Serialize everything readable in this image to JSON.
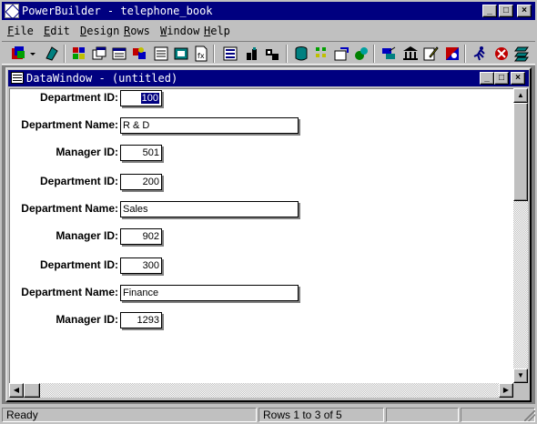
{
  "app": {
    "title": "PowerBuilder - telephone_book",
    "buttons": {
      "minimize": "_",
      "maximize": "□",
      "close": "×"
    }
  },
  "menu": [
    {
      "accel": "F",
      "rest": "ile"
    },
    {
      "accel": "E",
      "rest": "dit"
    },
    {
      "accel": "D",
      "rest": "esign"
    },
    {
      "accel": "R",
      "rest": "ows"
    },
    {
      "accel": "W",
      "rest": "indow"
    },
    {
      "accel": "H",
      "rest": "elp"
    }
  ],
  "toolbar": {
    "icons": [
      "new-wizard-icon",
      "dropdown-arrow-icon",
      "open-icon",
      "application-icon",
      "window-icon",
      "menu-icon",
      "structure-icon",
      "datawindow-icon",
      "query-icon",
      "function-icon",
      "library-icon",
      "run-icon",
      "debug-icon",
      "database-icon",
      "database-painter-icon",
      "pipeline-icon",
      "report-icon",
      "object-browser-icon",
      "preview-icon",
      "bank-icon",
      "edit-icon",
      "color-icon",
      "runner-icon",
      "stop-icon",
      "library-painter-icon"
    ]
  },
  "datawindow": {
    "title": "DataWindow - (untitled)",
    "records": [
      {
        "dept_id_label": "Department ID:",
        "dept_id": "100",
        "dept_name_label": "Department Name:",
        "dept_name": "R & D",
        "manager_label": "Manager ID:",
        "manager_id": "501"
      },
      {
        "dept_id_label": "Department ID:",
        "dept_id": "200",
        "dept_name_label": "Department Name:",
        "dept_name": "Sales",
        "manager_label": "Manager ID:",
        "manager_id": "902"
      },
      {
        "dept_id_label": "Department ID:",
        "dept_id": "300",
        "dept_name_label": "Department Name:",
        "dept_name": "Finance",
        "manager_label": "Manager ID:",
        "manager_id": "1293"
      }
    ]
  },
  "scroll": {
    "up": "▲",
    "down": "▼",
    "left": "◀",
    "right": "▶"
  },
  "status": {
    "message": "Ready",
    "rows": "Rows 1 to 3 of 5"
  }
}
